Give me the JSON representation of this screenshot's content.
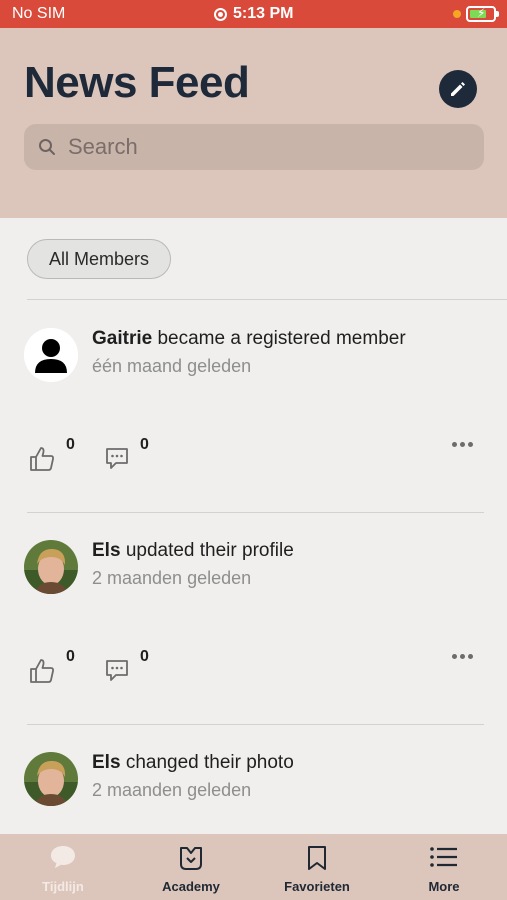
{
  "status_bar": {
    "carrier": "No SIM",
    "time": "5:13 PM"
  },
  "header": {
    "title": "News Feed",
    "search_placeholder": "Search"
  },
  "filter": {
    "label": "All Members"
  },
  "feed": [
    {
      "user": "Gaitrie",
      "action": "became a registered member",
      "time": "één maand geleden",
      "likes": "0",
      "comments": "0"
    },
    {
      "user": "Els",
      "action": "updated their profile",
      "time": "2 maanden geleden",
      "likes": "0",
      "comments": "0"
    },
    {
      "user": "Els",
      "action": "changed their photo",
      "time": "2 maanden geleden"
    }
  ],
  "tabs": [
    {
      "label": "Tijdlijn",
      "icon": "chat-bubble-icon",
      "active": true
    },
    {
      "label": "Academy",
      "icon": "academy-icon"
    },
    {
      "label": "Favorieten",
      "icon": "bookmark-icon"
    },
    {
      "label": "More",
      "icon": "list-icon"
    }
  ],
  "colors": {
    "header_bg": "#dcc6bb",
    "status_bar_bg": "#d94a3b",
    "title": "#1e2a3a",
    "page_bg": "#f0efed"
  }
}
